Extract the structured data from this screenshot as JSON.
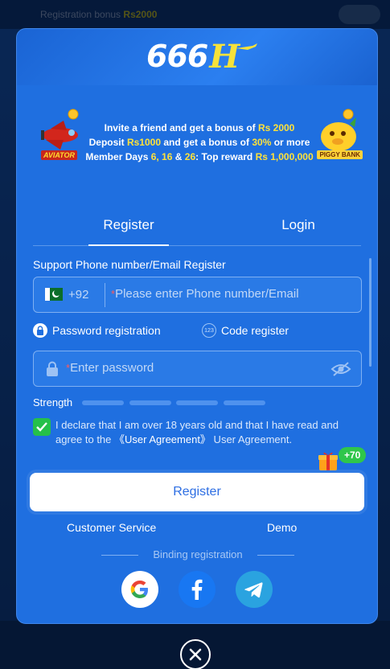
{
  "background": {
    "topbar_text": "Registration bonus",
    "topbar_highlight": "Rs2000"
  },
  "logo": {
    "text": "666",
    "letter": "H"
  },
  "promo": {
    "line1_a": "Invite a friend and get a bonus of ",
    "line1_b": "Rs 2000",
    "line2_a": "Deposit ",
    "line2_b": "Rs1000",
    "line2_c": " and get a bonus of ",
    "line2_d": "30%",
    "line2_e": " or more",
    "line3_a": "Member Days ",
    "line3_b": "6, 16",
    "line3_c": " & ",
    "line3_d": "26",
    "line3_e": ": Top reward ",
    "line3_f": "Rs 1,000,000",
    "aviator_label": "AVIATOR",
    "piggy_label": "PIGGY BANK"
  },
  "tabs": {
    "register": "Register",
    "login": "Login"
  },
  "form": {
    "section_title": "Support Phone number/Email Register",
    "country_code": "+92",
    "required_mark": "*",
    "phone_placeholder": "Please enter Phone number/Email",
    "mode_password": "Password registration",
    "mode_code": "Code register",
    "mode_code_icon_text": "123",
    "password_placeholder": "Enter password",
    "strength_label": "Strength",
    "agree_a": "I declare that I am over 18 years old and that I have read and agree to the ",
    "agree_link": "《User Agreement》",
    "agree_b": " User Agreement."
  },
  "gift": {
    "badge": "+70"
  },
  "register_button": "Register",
  "links": {
    "customer_service": "Customer Service",
    "demo": "Demo"
  },
  "binding": "Binding registration",
  "colors": {
    "modal_bg": "#1f6fe0",
    "accent_yellow": "#ffe23a",
    "check_green": "#25c04a",
    "button_text": "#2d6ee3"
  },
  "icons": [
    "pakistan-flag-icon",
    "lock-icon",
    "eye-off-icon",
    "google-icon",
    "facebook-icon",
    "telegram-icon",
    "close-icon",
    "gift-icon",
    "checkmark-icon"
  ]
}
